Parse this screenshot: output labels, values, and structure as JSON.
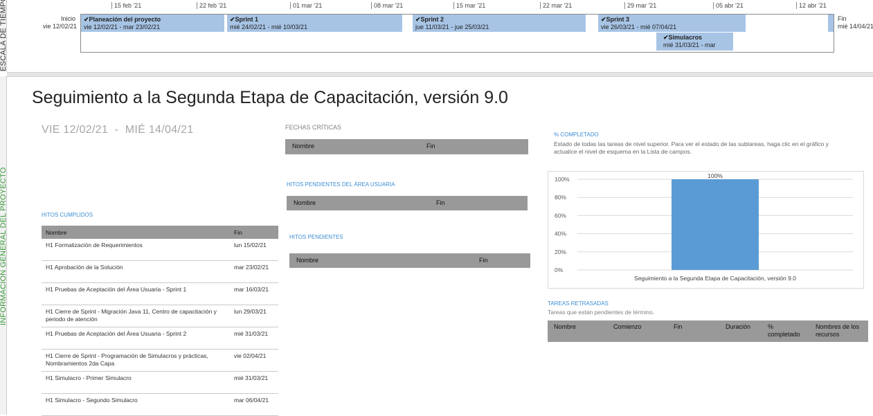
{
  "side_labels": {
    "timeline": "ESCALA DE TIEMPO",
    "overview": "INFORMACIÓN GENERAL DEL PROYECTO"
  },
  "timeline": {
    "ticks": [
      "15 feb '21",
      "22 feb '21",
      "01 mar '21",
      "08 mar '21",
      "15 mar '21",
      "22 mar '21",
      "29 mar '21",
      "05 abr '21",
      "12 abr '21"
    ],
    "start": {
      "label": "Inicio",
      "date": "vie 12/02/21"
    },
    "end": {
      "label": "Fin",
      "date": "mié 14/04/21"
    },
    "bars": [
      {
        "title": "Planeación del proyecto",
        "dates": "vie 12/02/21 - mar 23/02/21",
        "check": "✔"
      },
      {
        "title": "Sprint 1",
        "dates": "mié 24/02/21 - mié 10/03/21",
        "check": "✔"
      },
      {
        "title": "Sprint 2",
        "dates": "jue 11/03/21 - jue 25/03/21",
        "check": "✔"
      },
      {
        "title": "Sprint 3",
        "dates": "vie 26/03/21 - mié 07/04/21",
        "check": "✔"
      },
      {
        "title": "Simulacros",
        "dates": "mié 31/03/21 - mar",
        "check": "✔"
      }
    ],
    "bar_color": "#a7c4e5"
  },
  "report": {
    "title": "Seguimiento a la Segunda Etapa de Capacitación, versión 9.0",
    "date_start": "VIE 12/02/21",
    "date_sep": "-",
    "date_end": "MIÉ 14/04/21"
  },
  "fechas_criticas": {
    "heading": "FECHAS CRÍTICAS",
    "col_nombre": "Nombre",
    "col_fin": "Fin"
  },
  "hitos_area_usuaria": {
    "heading": "HITOS PENDIENTES DEL ÁREA USUARIA",
    "col_nombre": "Nombre",
    "col_fin": "Fin"
  },
  "hitos_pendientes": {
    "heading": "HITOS PENDIENTES",
    "col_nombre": "Nombre",
    "col_fin": "Fin"
  },
  "hitos_cumplidos": {
    "heading": "HITOS CUMPLIDOS",
    "col_nombre": "Nombre",
    "col_fin": "Fin",
    "rows": [
      {
        "nombre": "H1 Formalización de Requerimientos",
        "fin": "lun 15/02/21"
      },
      {
        "nombre": "H1 Aprobación de la Solución",
        "fin": "mar 23/02/21"
      },
      {
        "nombre": "H1 Pruebas de Aceptación del Área Usuaria - Sprint 1",
        "fin": "mar 16/03/21"
      },
      {
        "nombre": "H1 Cierre de Sprint - Migración Java 11, Centro de capacitación y periodo de atención",
        "fin": "lun 29/03/21"
      },
      {
        "nombre": "H1 Pruebas de Aceptación del Área Usuaria - Sprint 2",
        "fin": "mié 31/03/21"
      },
      {
        "nombre": "H1 Cierre de Sprint - Programación de Simulacros y prácticas, Nombramientos 2da Capa",
        "fin": "vie 02/04/21"
      },
      {
        "nombre": "H1 Simulacro - Primer Simulacro",
        "fin": "mié 31/03/21"
      },
      {
        "nombre": "H1 Simulacro - Segundo Simulacro",
        "fin": "mar 06/04/21"
      }
    ]
  },
  "completado": {
    "heading": "% COMPLETADO",
    "description": "Estado de todas las tareas de nivel superior. Para ver el estado de las subtareas, haga clic en el gráfico y actualice el nivel de esquema en la Lista de campos."
  },
  "chart_data": {
    "type": "bar",
    "categories": [
      "Seguimiento a la Segunda Etapa de Capacitación, versión 9.0"
    ],
    "values": [
      100
    ],
    "value_labels": [
      "100%"
    ],
    "y_ticks": [
      "0%",
      "20%",
      "40%",
      "60%",
      "80%",
      "100%"
    ],
    "ylim": [
      0,
      100
    ],
    "grid": true,
    "bar_color": "#5b9bd5"
  },
  "tareas_retrasadas": {
    "heading": "TAREAS RETRASADAS",
    "subtitle": "Tareas que están pendientes de término.",
    "columns": [
      "Nombre",
      "Comienzo",
      "Fin",
      "Duración",
      "% completado",
      "Nombres de los recursos"
    ]
  }
}
